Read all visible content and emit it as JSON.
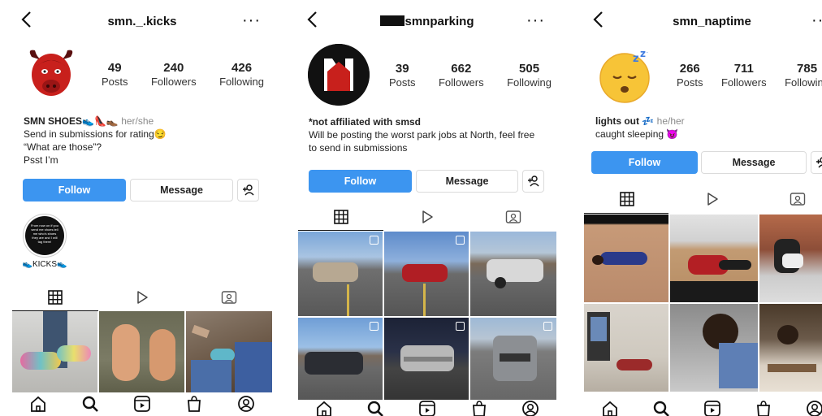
{
  "profiles": [
    {
      "username": "smn._.kicks",
      "stats": [
        {
          "num": "49",
          "label": "Posts"
        },
        {
          "num": "240",
          "label": "Followers"
        },
        {
          "num": "426",
          "label": "Following"
        }
      ],
      "bio_name": "SMN SHOES",
      "bio_emoji": "👟👠👞",
      "pronouns": "her/she",
      "bio_lines": [
        "Send in submissions for rating😏",
        "“What are those”?",
        "Psst I’m"
      ],
      "follow": "Follow",
      "message": "Message",
      "highlight_label": "👟KICKS👟",
      "highlight_text": "From now on if you send me shoes tell me who's shoes they are and I will tag them!"
    },
    {
      "username": "smnparking",
      "stats": [
        {
          "num": "39",
          "label": "Posts"
        },
        {
          "num": "662",
          "label": "Followers"
        },
        {
          "num": "505",
          "label": "Following"
        }
      ],
      "bio_name": "*not affiliated with smsd",
      "bio_lines": [
        "Will be posting the worst park jobs at North, feel free",
        "to send in submissions"
      ],
      "follow": "Follow",
      "message": "Message"
    },
    {
      "username": "smn_naptime",
      "stats": [
        {
          "num": "266",
          "label": "Posts"
        },
        {
          "num": "711",
          "label": "Followers"
        },
        {
          "num": "785",
          "label": "Following"
        }
      ],
      "bio_name": "lights out",
      "bio_emoji": "💤",
      "pronouns": "he/her",
      "bio_lines": [
        "caught sleeping 😈"
      ],
      "follow": "Follow",
      "message": "Message"
    }
  ],
  "colors": {
    "accent": "#3c95f0",
    "border": "#dbdbdb",
    "muted": "#8a8a8a"
  },
  "icons": [
    "back-arrow-icon",
    "more-icon",
    "grid-icon",
    "reels-icon",
    "tagged-icon",
    "add-person-icon",
    "home-icon",
    "search-icon",
    "reels-nav-icon",
    "shop-icon",
    "profile-icon"
  ]
}
